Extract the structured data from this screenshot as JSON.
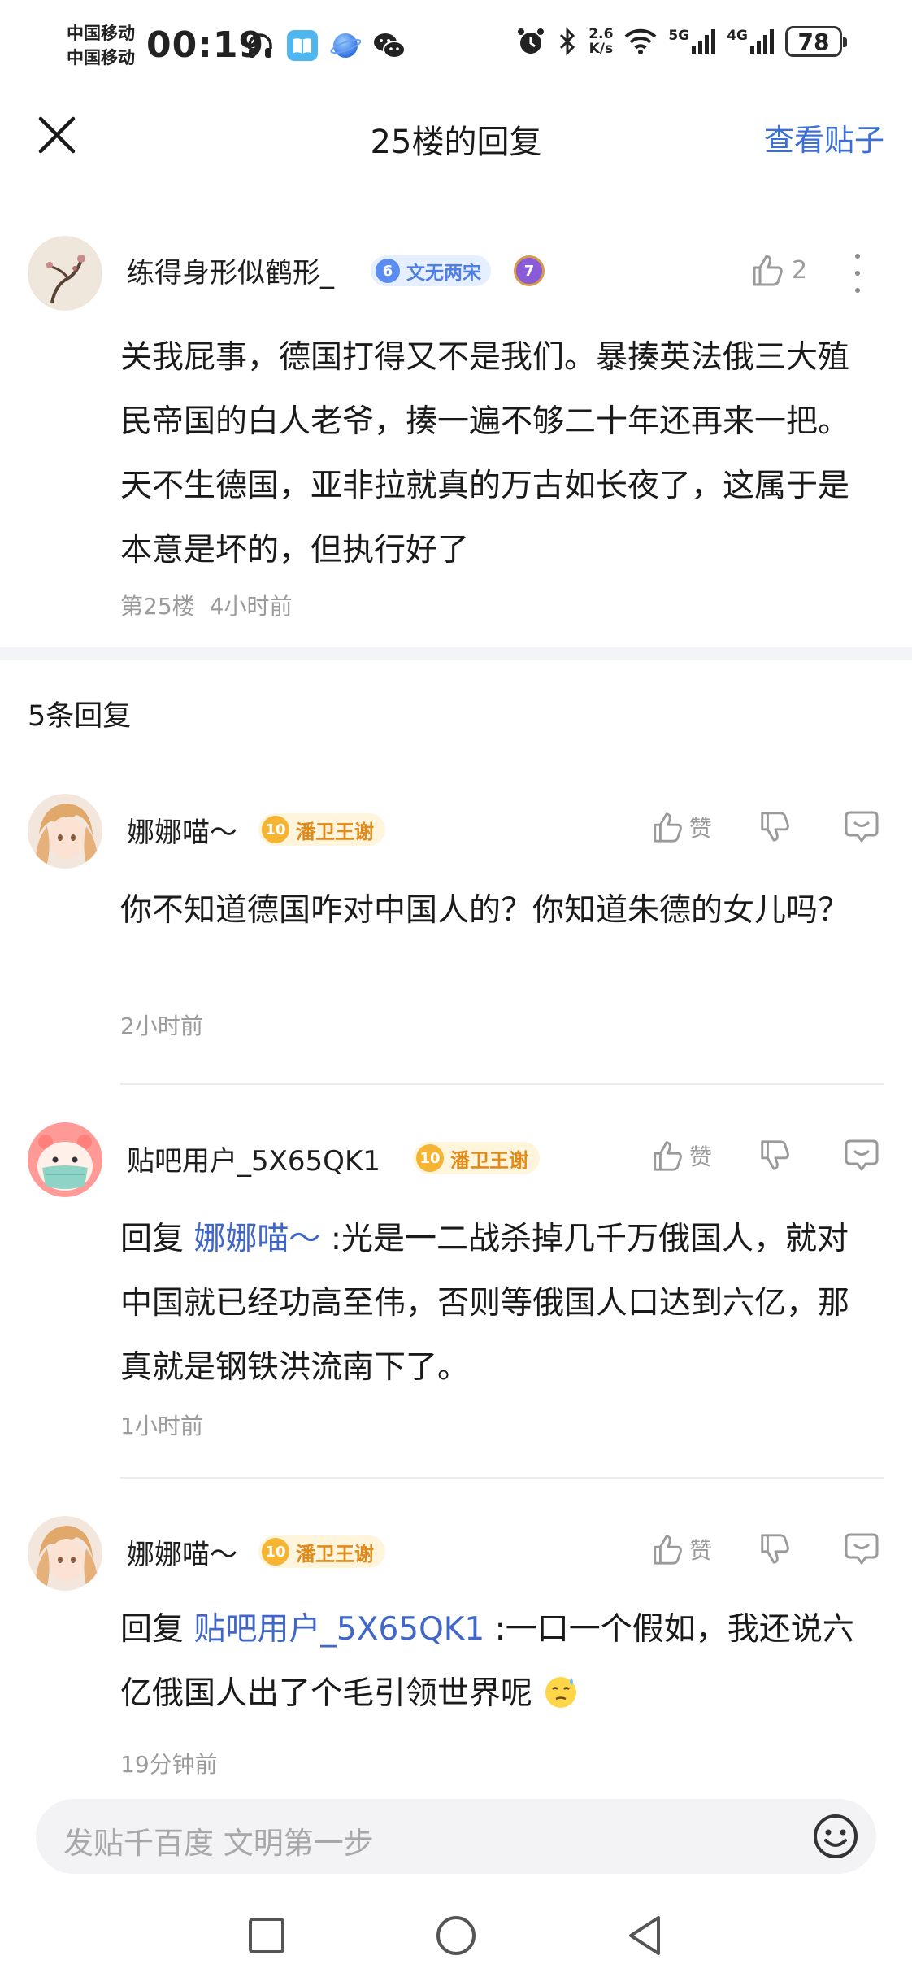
{
  "status_bar": {
    "carrier_1": "中国移动",
    "carrier_2": "中国移动",
    "time": "00:19",
    "net_speed_value": "2.6",
    "net_speed_unit": "K/s",
    "signal_1": "5G",
    "signal_2": "4G",
    "battery": "78",
    "left_icons": [
      "headphones-icon",
      "reader-app-icon",
      "browser-app-icon",
      "wechat-icon"
    ],
    "right_icons": [
      "alarm-icon",
      "bluetooth-icon",
      "wifi-icon",
      "signal-icon",
      "battery-icon"
    ]
  },
  "nav": {
    "title": "25楼的回复",
    "right_link": "查看贴子"
  },
  "post": {
    "author": "练得身形似鹤形_",
    "level": "6",
    "title_badge": "文无两宋",
    "vip_level": "7",
    "like_count": "2",
    "content": "关我屁事，德国打得又不是我们。暴揍英法俄三大殖民帝国的白人老爷，揍一遍不够二十年还再来一把。天不生德国，亚非拉就真的万古如长夜了，这属于是本意是坏的，但执行好了",
    "floor": "第25楼",
    "time": "4小时前"
  },
  "replies_header": "5条回复",
  "actions": {
    "like_label": "赞"
  },
  "replies": [
    {
      "author": "娜娜喵～",
      "level": "10",
      "badge": "潘卫王谢",
      "prefix": "",
      "mention": "",
      "content": "你不知道德国咋对中国人的？你知道朱德的女儿吗？",
      "time": "2小时前"
    },
    {
      "author": "贴吧用户_5X65QK1",
      "level": "10",
      "badge": "潘卫王谢",
      "prefix": "回复",
      "mention": "娜娜喵～",
      "content": ":光是一二战杀掉几千万俄国人，就对中国就已经功高至伟，否则等俄国人口达到六亿，那真就是钢铁洪流南下了。",
      "time": "1小时前"
    },
    {
      "author": "娜娜喵～",
      "level": "10",
      "badge": "潘卫王谢",
      "prefix": "回复",
      "mention": "贴吧用户_5X65QK1",
      "content": ":一口一个假如，我还说六亿俄国人出了个毛引领世界呢",
      "time": "19分钟前"
    }
  ],
  "input": {
    "placeholder": "发贴千百度 文明第一步"
  },
  "colors": {
    "accent_blue": "#3b6fd8",
    "mention_blue": "#3f66c8",
    "meta_gray": "#9b9b9b",
    "badge_gold": "#f5b432"
  }
}
